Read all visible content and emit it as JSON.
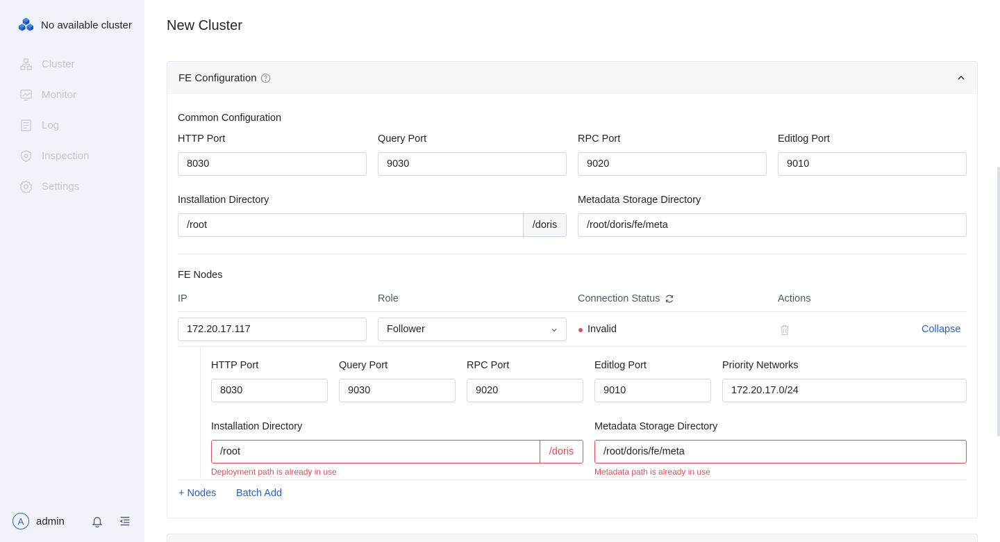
{
  "sidebar": {
    "brand": "No available cluster",
    "items": [
      {
        "label": "Cluster",
        "icon": "cluster-icon"
      },
      {
        "label": "Monitor",
        "icon": "monitor-icon"
      },
      {
        "label": "Log",
        "icon": "log-icon"
      },
      {
        "label": "Inspection",
        "icon": "inspection-icon"
      },
      {
        "label": "Settings",
        "icon": "gear-icon"
      }
    ],
    "user_initial": "A",
    "user_name": "admin"
  },
  "page": {
    "title": "New Cluster"
  },
  "fe_config": {
    "title": "FE Configuration",
    "common": {
      "title": "Common Configuration",
      "http_port_label": "HTTP Port",
      "http_port": "8030",
      "query_port_label": "Query Port",
      "query_port": "9030",
      "rpc_port_label": "RPC Port",
      "rpc_port": "9020",
      "editlog_port_label": "Editlog Port",
      "editlog_port": "9010",
      "install_dir_label": "Installation Directory",
      "install_dir": "/root",
      "install_suffix": "/doris",
      "meta_dir_label": "Metadata Storage Directory",
      "meta_dir": "/root/doris/fe/meta"
    },
    "nodes": {
      "title": "FE Nodes",
      "col_ip": "IP",
      "col_role": "Role",
      "col_status": "Connection Status",
      "col_actions": "Actions",
      "rows": [
        {
          "ip": "172.20.17.117",
          "role": "Follower",
          "status": "Invalid",
          "collapse": "Collapse",
          "http_port_label": "HTTP Port",
          "http_port": "8030",
          "query_port_label": "Query Port",
          "query_port": "9030",
          "rpc_port_label": "RPC Port",
          "rpc_port": "9020",
          "editlog_port_label": "Editlog Port",
          "editlog_port": "9010",
          "priority_label": "Priority Networks",
          "priority": "172.20.17.0/24",
          "install_dir_label": "Installation Directory",
          "install_dir": "/root",
          "install_suffix": "/doris",
          "install_error": "Deployment path is already in use",
          "meta_dir_label": "Metadata Storage Directory",
          "meta_dir": "/root/doris/fe/meta",
          "meta_error": "Metadata path is already in use"
        }
      ],
      "add_nodes": "+ Nodes",
      "batch_add": "Batch Add"
    }
  },
  "colors": {
    "accent": "#2860c7",
    "error": "#e34d59",
    "sidebar_bg": "#f0f3fa"
  }
}
